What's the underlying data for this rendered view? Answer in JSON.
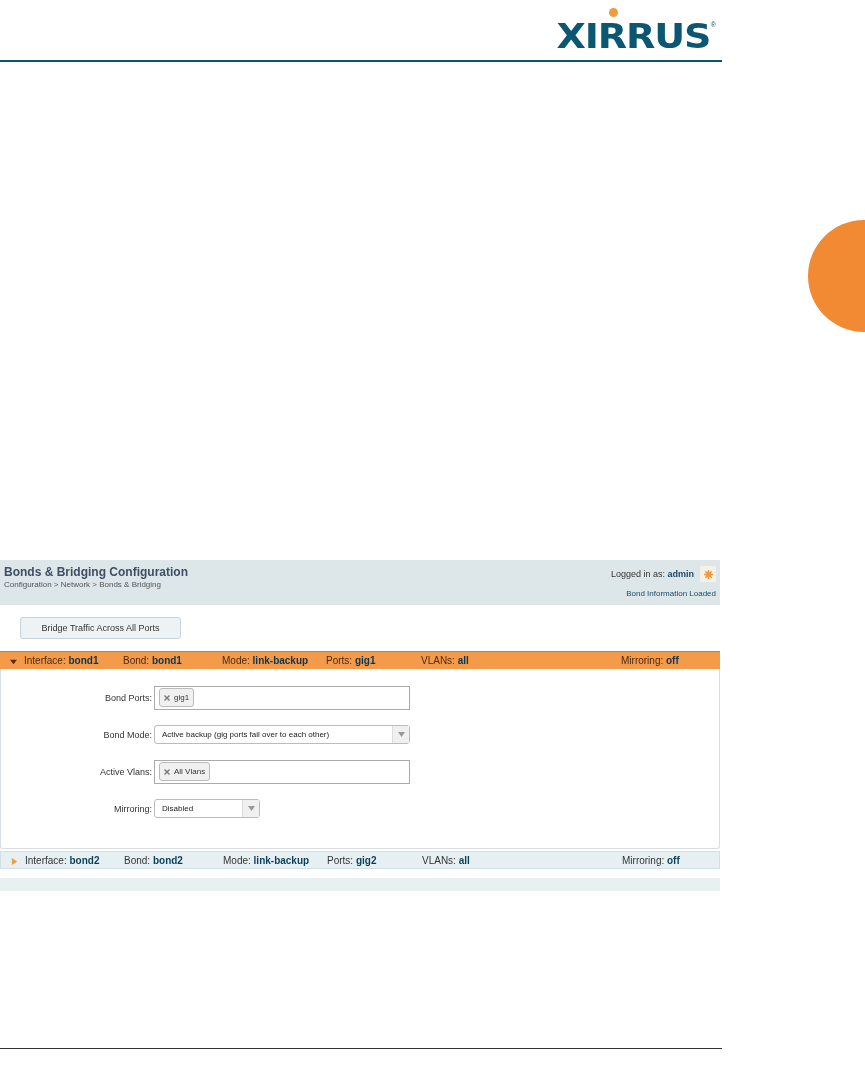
{
  "logo": {
    "text": "XIRRUS",
    "mark": "®"
  },
  "screen": {
    "title": "Bonds & Bridging Configuration",
    "breadcrumb": "Configuration > Network > Bonds & Bridging",
    "login_label": "Logged in as:",
    "login_user": "admin",
    "status": "Bond Information Loaded",
    "bridge_button": "Bridge Traffic Across All Ports",
    "bonds": [
      {
        "expanded": true,
        "labels": {
          "interface": "Interface:",
          "bond": "Bond:",
          "mode": "Mode:",
          "ports": "Ports:",
          "vlans": "VLANs:",
          "mirroring": "Mirroring:"
        },
        "interface": "bond1",
        "bond": "bond1",
        "mode": "link-backup",
        "ports": "gig1",
        "vlans": "all",
        "mirroring": "off",
        "fields": [
          {
            "label": "Bond Ports:",
            "kind": "tags",
            "tags": [
              "gig1"
            ]
          },
          {
            "label": "Bond Mode:",
            "kind": "select",
            "value": "Active backup (gig ports fail over to each other)",
            "wide": true
          },
          {
            "label": "Active Vlans:",
            "kind": "tags",
            "tags": [
              "All Vlans"
            ]
          },
          {
            "label": "Mirroring:",
            "kind": "select",
            "value": "Disabled",
            "wide": false
          }
        ]
      },
      {
        "expanded": false,
        "labels": {
          "interface": "Interface:",
          "bond": "Bond:",
          "mode": "Mode:",
          "ports": "Ports:",
          "vlans": "VLANs:",
          "mirroring": "Mirroring:"
        },
        "interface": "bond2",
        "bond": "bond2",
        "mode": "link-backup",
        "ports": "gig2",
        "vlans": "all",
        "mirroring": "off"
      }
    ]
  }
}
